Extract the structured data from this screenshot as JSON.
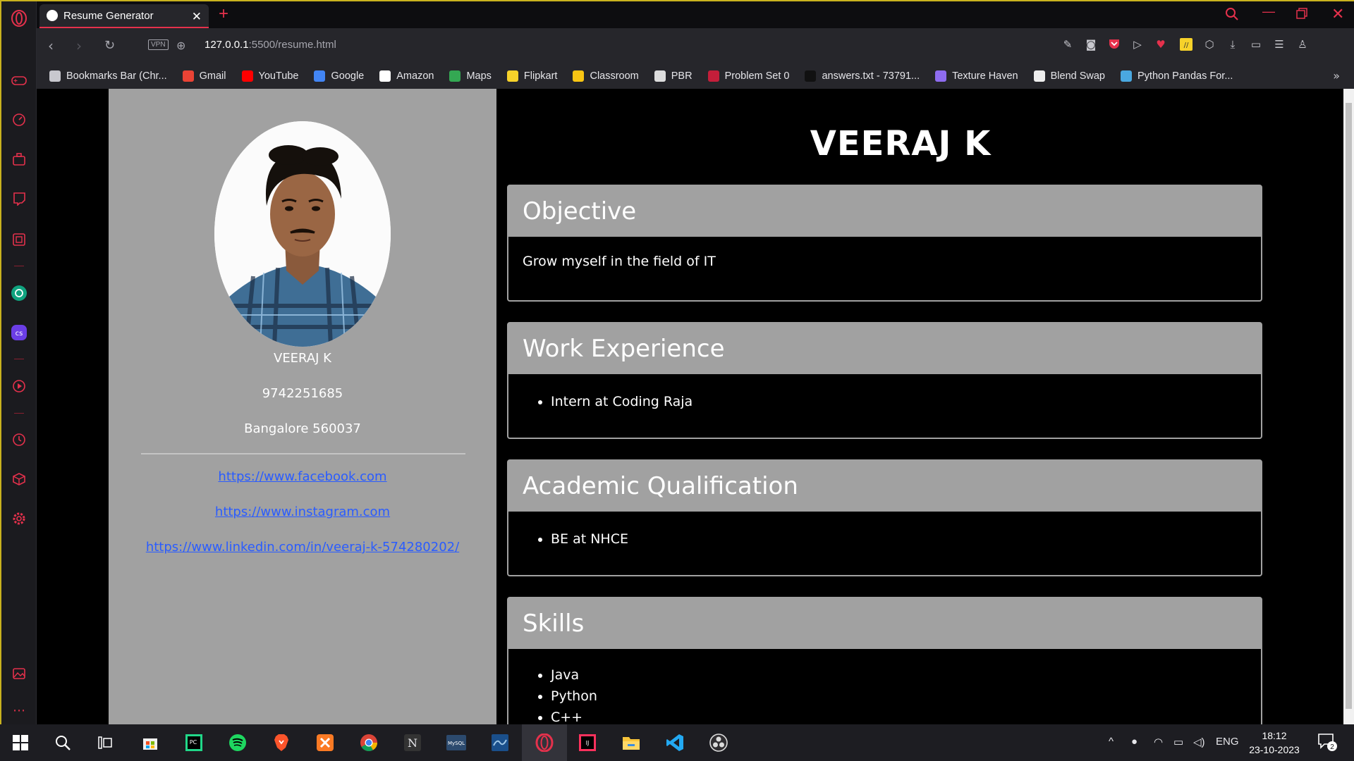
{
  "browser": {
    "tab_title": "Resume Generator",
    "tab_close": "✕",
    "new_tab": "+",
    "url_host": "127.0.0.1",
    "url_path": ":5500/resume.html",
    "vpn_label": "VPN",
    "bookmarks": [
      {
        "label": "Bookmarks Bar (Chr...",
        "icon": "folder-icon",
        "color": "#c8c8ce"
      },
      {
        "label": "Gmail",
        "icon": "gmail-icon",
        "color": "#ea4335"
      },
      {
        "label": "YouTube",
        "icon": "youtube-icon",
        "color": "#ff0000"
      },
      {
        "label": "Google",
        "icon": "google-icon",
        "color": "#4285f4"
      },
      {
        "label": "Amazon",
        "icon": "amazon-icon",
        "color": "#ffffff"
      },
      {
        "label": "Maps",
        "icon": "maps-icon",
        "color": "#34a853"
      },
      {
        "label": "Flipkart",
        "icon": "flipkart-icon",
        "color": "#f7d22a"
      },
      {
        "label": "Classroom",
        "icon": "classroom-icon",
        "color": "#f9c513"
      },
      {
        "label": "PBR",
        "icon": "pbr-icon",
        "color": "#dddddd"
      },
      {
        "label": "Problem Set 0",
        "icon": "harvard-icon",
        "color": "#c41e3a"
      },
      {
        "label": "answers.txt - 73791...",
        "icon": "github-icon",
        "color": "#111111"
      },
      {
        "label": "Texture Haven",
        "icon": "texture-haven-icon",
        "color": "#8e6cf0"
      },
      {
        "label": "Blend Swap",
        "icon": "blend-swap-icon",
        "color": "#eeeeee"
      },
      {
        "label": "Python Pandas For...",
        "icon": "pandas-icon",
        "color": "#4aa8e0"
      }
    ],
    "more_bookmarks": "»"
  },
  "resume": {
    "name_left": "VEERAJ K",
    "phone": "9742251685",
    "address": "Bangalore 560037",
    "links": [
      "https://www.facebook.com",
      "https://www.instagram.com",
      "https://www.linkedin.com/in/veeraj-k-574280202/"
    ],
    "name_title": "VEERAJ K",
    "sections": {
      "objective": {
        "title": "Objective",
        "text": "Grow myself in the field of IT"
      },
      "work": {
        "title": "Work Experience",
        "items": [
          "Intern at Coding Raja"
        ]
      },
      "academic": {
        "title": "Academic Qualification",
        "items": [
          "BE at NHCE"
        ]
      },
      "skills": {
        "title": "Skills",
        "items": [
          "Java",
          "Python",
          "C++"
        ]
      }
    }
  },
  "taskbar": {
    "lang": "ENG",
    "time": "18:12",
    "date": "23-10-2023",
    "notification_count": "2"
  },
  "colors": {
    "accent": "#e5314c",
    "panel_gray": "#a1a1a1",
    "link_blue": "#2a5cff",
    "frame_yellow": "#c9b21e"
  }
}
